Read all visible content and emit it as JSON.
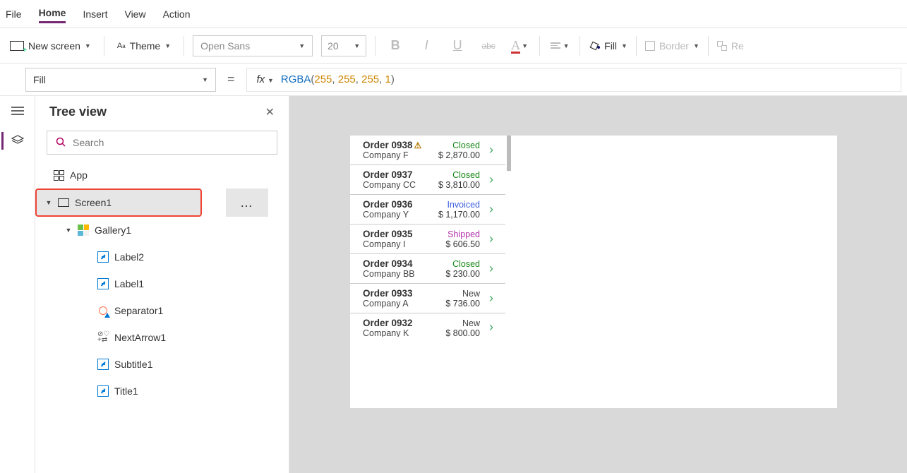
{
  "menu": {
    "file": "File",
    "home": "Home",
    "insert": "Insert",
    "view": "View",
    "action": "Action"
  },
  "ribbon": {
    "newScreen": "New screen",
    "theme": "Theme",
    "fontName": "Open Sans",
    "fontSize": "20",
    "fill": "Fill",
    "border": "Border",
    "reorder": "Re"
  },
  "formulaBar": {
    "property": "Fill",
    "fxLabel": "fx",
    "formulaPlain": "RGBA(255, 255, 255, 1)",
    "tokens": {
      "fn": "RGBA",
      "lp": "(",
      "a": "255",
      "c1": ", ",
      "b": "255",
      "c2": ", ",
      "c": "255",
      "c3": ", ",
      "d": "1",
      "rp": ")"
    }
  },
  "treePanel": {
    "title": "Tree view",
    "searchPlaceholder": "Search",
    "app": "App",
    "screen": "Screen1",
    "more": "…",
    "gallery": "Gallery1",
    "children": {
      "label2": "Label2",
      "label1": "Label1",
      "separator1": "Separator1",
      "nextArrow1": "NextArrow1",
      "subtitle1": "Subtitle1",
      "title1": "Title1"
    }
  },
  "orders": [
    {
      "title": "Order 0938",
      "warn": true,
      "status": "Closed",
      "statusCls": "st-closed",
      "sub": "Company F",
      "amt": "$ 2,870.00"
    },
    {
      "title": "Order 0937",
      "warn": false,
      "status": "Closed",
      "statusCls": "st-closed",
      "sub": "Company CC",
      "amt": "$ 3,810.00"
    },
    {
      "title": "Order 0936",
      "warn": false,
      "status": "Invoiced",
      "statusCls": "st-invoiced",
      "sub": "Company Y",
      "amt": "$ 1,170.00"
    },
    {
      "title": "Order 0935",
      "warn": false,
      "status": "Shipped",
      "statusCls": "st-shipped",
      "sub": "Company I",
      "amt": "$ 606.50"
    },
    {
      "title": "Order 0934",
      "warn": false,
      "status": "Closed",
      "statusCls": "st-closed",
      "sub": "Company BB",
      "amt": "$ 230.00"
    },
    {
      "title": "Order 0933",
      "warn": false,
      "status": "New",
      "statusCls": "st-new",
      "sub": "Company A",
      "amt": "$ 736.00"
    },
    {
      "title": "Order 0932",
      "warn": false,
      "status": "New",
      "statusCls": "st-new",
      "sub": "Company K",
      "amt": "$ 800.00"
    }
  ]
}
